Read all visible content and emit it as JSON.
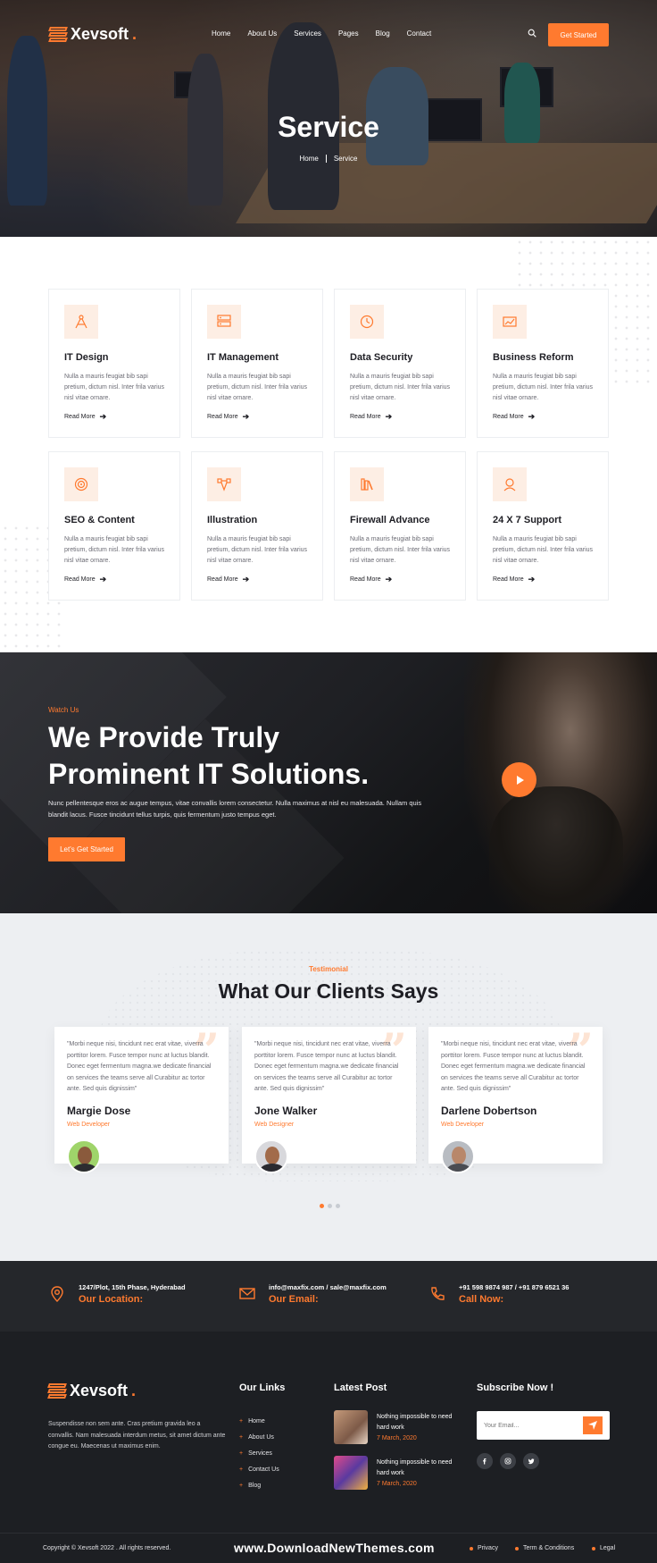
{
  "brand": {
    "name": "Xevsoft",
    "dot": ".",
    "accent_color": "#ff7a2f"
  },
  "nav": {
    "items": [
      "Home",
      "About Us",
      "Services",
      "Pages",
      "Blog",
      "Contact"
    ],
    "search_icon": "search-icon",
    "cta_label": "Get Started"
  },
  "hero": {
    "title": "Service",
    "breadcrumb": {
      "home": "Home",
      "current": "Service"
    }
  },
  "services": [
    {
      "title": "IT Design",
      "icon": "design-compass-icon",
      "desc": "Nulla a mauris feugiat bib sapi pretium, dictum nisl. Inter frila varius nisl vitae ornare.",
      "more": "Read More"
    },
    {
      "title": "IT Management",
      "icon": "server-icon",
      "desc": "Nulla a mauris feugiat bib sapi pretium, dictum nisl. Inter frila varius nisl vitae ornare.",
      "more": "Read More"
    },
    {
      "title": "Data Security",
      "icon": "clock-icon",
      "desc": "Nulla a mauris feugiat bib sapi pretium, dictum nisl. Inter frila varius nisl vitae ornare.",
      "more": "Read More"
    },
    {
      "title": "Business Reform",
      "icon": "chart-board-icon",
      "desc": "Nulla a mauris feugiat bib sapi pretium, dictum nisl. Inter frila varius nisl vitae ornare.",
      "more": "Read More"
    },
    {
      "title": "SEO & Content",
      "icon": "target-icon",
      "desc": "Nulla a mauris feugiat bib sapi pretium, dictum nisl. Inter frila varius nisl vitae ornare.",
      "more": "Read More"
    },
    {
      "title": "Illustration",
      "icon": "pen-tool-icon",
      "desc": "Nulla a mauris feugiat bib sapi pretium, dictum nisl. Inter frila varius nisl vitae ornare.",
      "more": "Read More"
    },
    {
      "title": "Firewall Advance",
      "icon": "books-icon",
      "desc": "Nulla a mauris feugiat bib sapi pretium, dictum nisl. Inter frila varius nisl vitae ornare.",
      "more": "Read More"
    },
    {
      "title": "24 X 7 Support",
      "icon": "support-icon",
      "desc": "Nulla a mauris feugiat bib sapi pretium, dictum nisl. Inter frila varius nisl vitae ornare.",
      "more": "Read More"
    }
  ],
  "watch": {
    "tag": "Watch Us",
    "title": "We Provide Truly Prominent IT Solutions.",
    "text": "Nunc pellentesque eros ac augue tempus, vitae convallis lorem consectetur. Nulla maximus at nisl eu malesuada. Nullam quis blandit lacus. Fusce tincidunt tellus turpis, quis fermentum justo tempus eget.",
    "cta_label": "Let's Get Started",
    "play_icon": "play-icon"
  },
  "testimonials": {
    "tag": "Testimonial",
    "title": "What Our Clients Says",
    "items": [
      {
        "text": "\"Morbi neque nisi, tincidunt nec erat vitae, viverra porttitor lorem. Fusce tempor nunc at luctus blandit. Donec eget fermentum magna.we dedicate financial on services the teams serve all Curabitur ac tortor ante. Sed quis dignissim\"",
        "name": "Margie Dose",
        "role": "Web Developer"
      },
      {
        "text": "\"Morbi neque nisi, tincidunt nec erat vitae, viverra porttitor lorem. Fusce tempor nunc at luctus blandit. Donec eget fermentum magna.we dedicate financial on services the teams serve all Curabitur ac tortor ante. Sed quis dignissim\"",
        "name": "Jone Walker",
        "role": "Web Designer"
      },
      {
        "text": "\"Morbi neque nisi, tincidunt nec erat vitae, viverra porttitor lorem. Fusce tempor nunc at luctus blandit. Donec eget fermentum magna.we dedicate financial on services the teams serve all Curabitur ac tortor ante. Sed quis dignissim\"",
        "name": "Darlene Dobertson",
        "role": "Web Developer"
      }
    ],
    "pager": {
      "count": 3,
      "active": 1
    }
  },
  "contact": [
    {
      "icon": "location-pin-icon",
      "value": "1247/Plot, 15th Phase, Hyderabad",
      "label": "Our Location:"
    },
    {
      "icon": "mail-icon",
      "value": "info@maxfix.com / sale@maxfix.com",
      "label": "Our Email:"
    },
    {
      "icon": "phone-icon",
      "value": "+91 598 9874 987 / +91 879 6521 36",
      "label": "Call Now:"
    }
  ],
  "footer": {
    "about": "Suspendisse non sem ante. Cras pretium gravida leo a convallis. Nam malesuada interdum metus, sit amet dictum ante congue eu. Maecenas ut maximus enim.",
    "links_title": "Our Links",
    "links": [
      "Home",
      "About Us",
      "Services",
      "Contact Us",
      "Blog"
    ],
    "posts_title": "Latest Post",
    "posts": [
      {
        "title": "Nothing impossible to need hard work",
        "date": "7 March, 2020"
      },
      {
        "title": "Nothing impossible to need hard work",
        "date": "7 March, 2020"
      }
    ],
    "subscribe_title": "Subscribe Now !",
    "email_placeholder": "Your Email...",
    "social": [
      "facebook-icon",
      "instagram-icon",
      "twitter-icon"
    ],
    "copyright": "Copyright © Xevsoft 2022 . All rights reserved.",
    "watermark": "www.DownloadNewThemes.com",
    "legal": [
      "Privacy",
      "Term & Conditions",
      "Legal"
    ]
  }
}
